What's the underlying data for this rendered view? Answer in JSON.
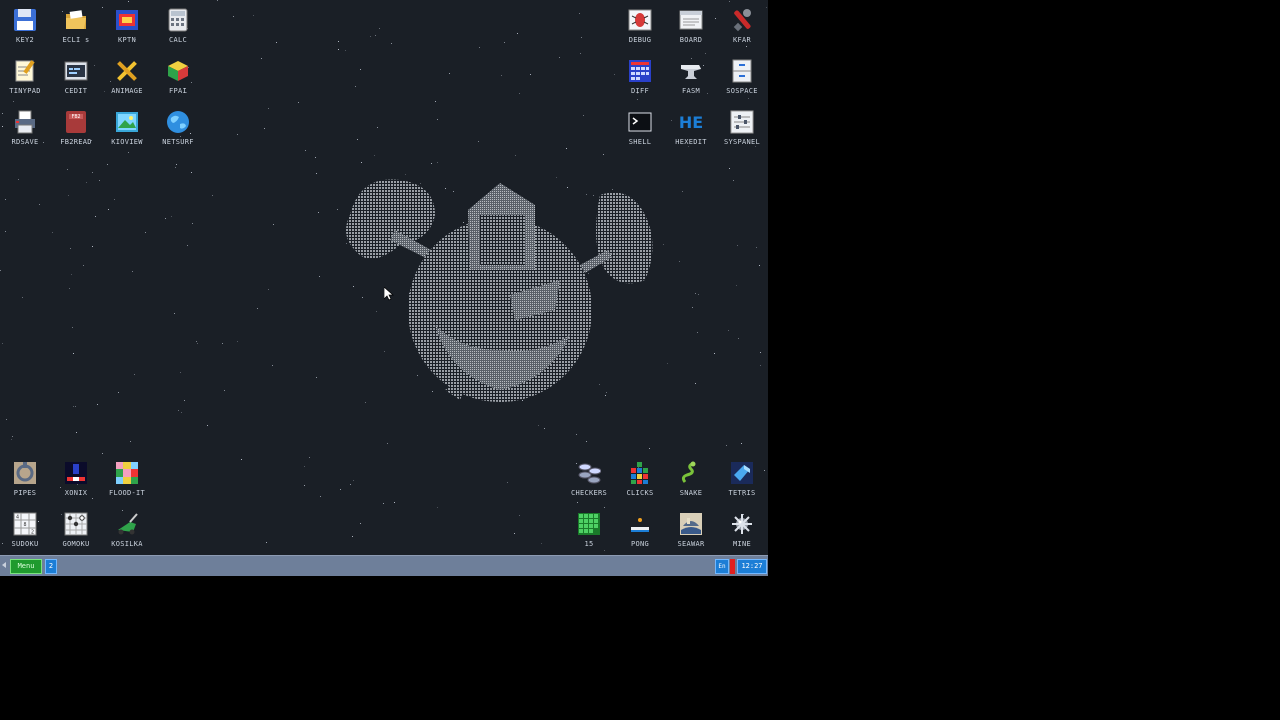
{
  "desktop": {
    "icons_top_left": [
      {
        "label": "KEY2",
        "icon": "floppy-disk-icon"
      },
      {
        "label": "ECLI s",
        "icon": "folder-icon"
      },
      {
        "label": "KPTN",
        "icon": "paint-icon"
      },
      {
        "label": "CALC",
        "icon": "calculator-icon"
      },
      {
        "label": "TINYPAD",
        "icon": "notepad-icon"
      },
      {
        "label": "CEDIT",
        "icon": "code-editor-icon"
      },
      {
        "label": "ANIMAGE",
        "icon": "pencil-ruler-icon"
      },
      {
        "label": "FPAI",
        "icon": "cube-icon"
      },
      {
        "label": "RDSAVE",
        "icon": "printer-icon"
      },
      {
        "label": "FB2READ",
        "icon": "book-icon"
      },
      {
        "label": "KIOVIEW",
        "icon": "image-viewer-icon"
      },
      {
        "label": "NETSURF",
        "icon": "globe-icon"
      }
    ],
    "icons_top_right": [
      {
        "label": "DEBUG",
        "icon": "bug-icon"
      },
      {
        "label": "BOARD",
        "icon": "board-icon"
      },
      {
        "label": "KFAR",
        "icon": "wrench-icon"
      },
      {
        "label": "DIFF",
        "icon": "calendar-grid-icon"
      },
      {
        "label": "FASM",
        "icon": "anvil-icon"
      },
      {
        "label": "SOSPACE",
        "icon": "cabinet-icon"
      },
      {
        "label": "SHELL",
        "icon": "terminal-icon"
      },
      {
        "label": "HEXEDIT",
        "icon": "hex-icon"
      },
      {
        "label": "SYSPANEL",
        "icon": "sliders-icon"
      }
    ],
    "icons_bottom_left": [
      {
        "label": "PIPES",
        "icon": "pipes-icon"
      },
      {
        "label": "XONIX",
        "icon": "xonix-icon"
      },
      {
        "label": "FLOOD-IT",
        "icon": "flood-grid-icon"
      },
      {
        "label": "SUDOKU",
        "icon": "sudoku-icon"
      },
      {
        "label": "GOMOKU",
        "icon": "gomoku-icon"
      },
      {
        "label": "KOSILKA",
        "icon": "lawnmower-icon"
      }
    ],
    "icons_bottom_right": [
      {
        "label": "CHECKERS",
        "icon": "checkers-icon"
      },
      {
        "label": "CLICKS",
        "icon": "blocks-icon"
      },
      {
        "label": "SNAKE",
        "icon": "snake-icon"
      },
      {
        "label": "TETRIS",
        "icon": "tetris-icon"
      },
      {
        "label": "15",
        "icon": "fifteen-grid-icon"
      },
      {
        "label": "PONG",
        "icon": "pong-icon"
      },
      {
        "label": "SEAWAR",
        "icon": "seawar-icon"
      },
      {
        "label": "MINE",
        "icon": "mine-icon"
      }
    ],
    "wallpaper": "planet-with-trees-icon"
  },
  "taskbar": {
    "menu_label": "Menu",
    "task_indicator": "2",
    "lang": "En",
    "clock": "12:27"
  },
  "colors": {
    "desktop_bg": "#1a1f26",
    "taskbar_bg": "#6e7f9a",
    "menu_green": "#1f9a2e",
    "indicator_blue": "#1c7ed6",
    "marker_red": "#e02020"
  }
}
